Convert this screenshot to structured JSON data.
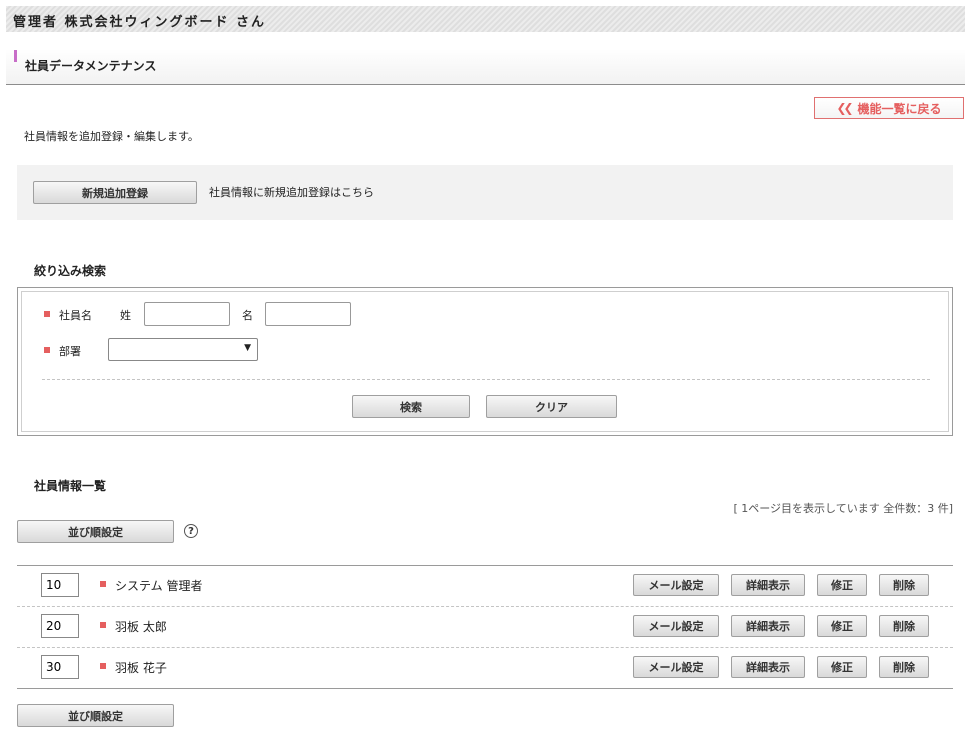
{
  "header": {
    "title": "管理者 株式会社ウィングボード さん"
  },
  "section": {
    "title": "社員データメンテナンス"
  },
  "back_button": {
    "label": "機能一覧に戻る"
  },
  "description": "社員情報を追加登録・編集します。",
  "new_registration": {
    "button_label": "新規追加登録",
    "hint": "社員情報に新規追加登録はこちら"
  },
  "filter": {
    "heading": "絞り込み検索",
    "employee_name_label": "社員名",
    "last_name_label": "姓",
    "first_name_label": "名",
    "last_name_value": "",
    "first_name_value": "",
    "department_label": "部署",
    "department_selected": "",
    "search_button": "検索",
    "clear_button": "クリア"
  },
  "list": {
    "heading": "社員情報一覧",
    "page_info": "[ 1ページ目を表示しています 全件数：3 件]",
    "sort_button": "並び順設定",
    "help_icon": "question-circle-icon",
    "action_labels": {
      "mail": "メール設定",
      "detail": "詳細表示",
      "edit": "修正",
      "delete": "削除"
    },
    "rows": [
      {
        "order": "10",
        "name": "システム 管理者"
      },
      {
        "order": "20",
        "name": "羽板 太郎"
      },
      {
        "order": "30",
        "name": "羽板 花子"
      }
    ]
  },
  "colors": {
    "accent_red": "#e55f5f",
    "section_mark": "#c86ec8"
  }
}
